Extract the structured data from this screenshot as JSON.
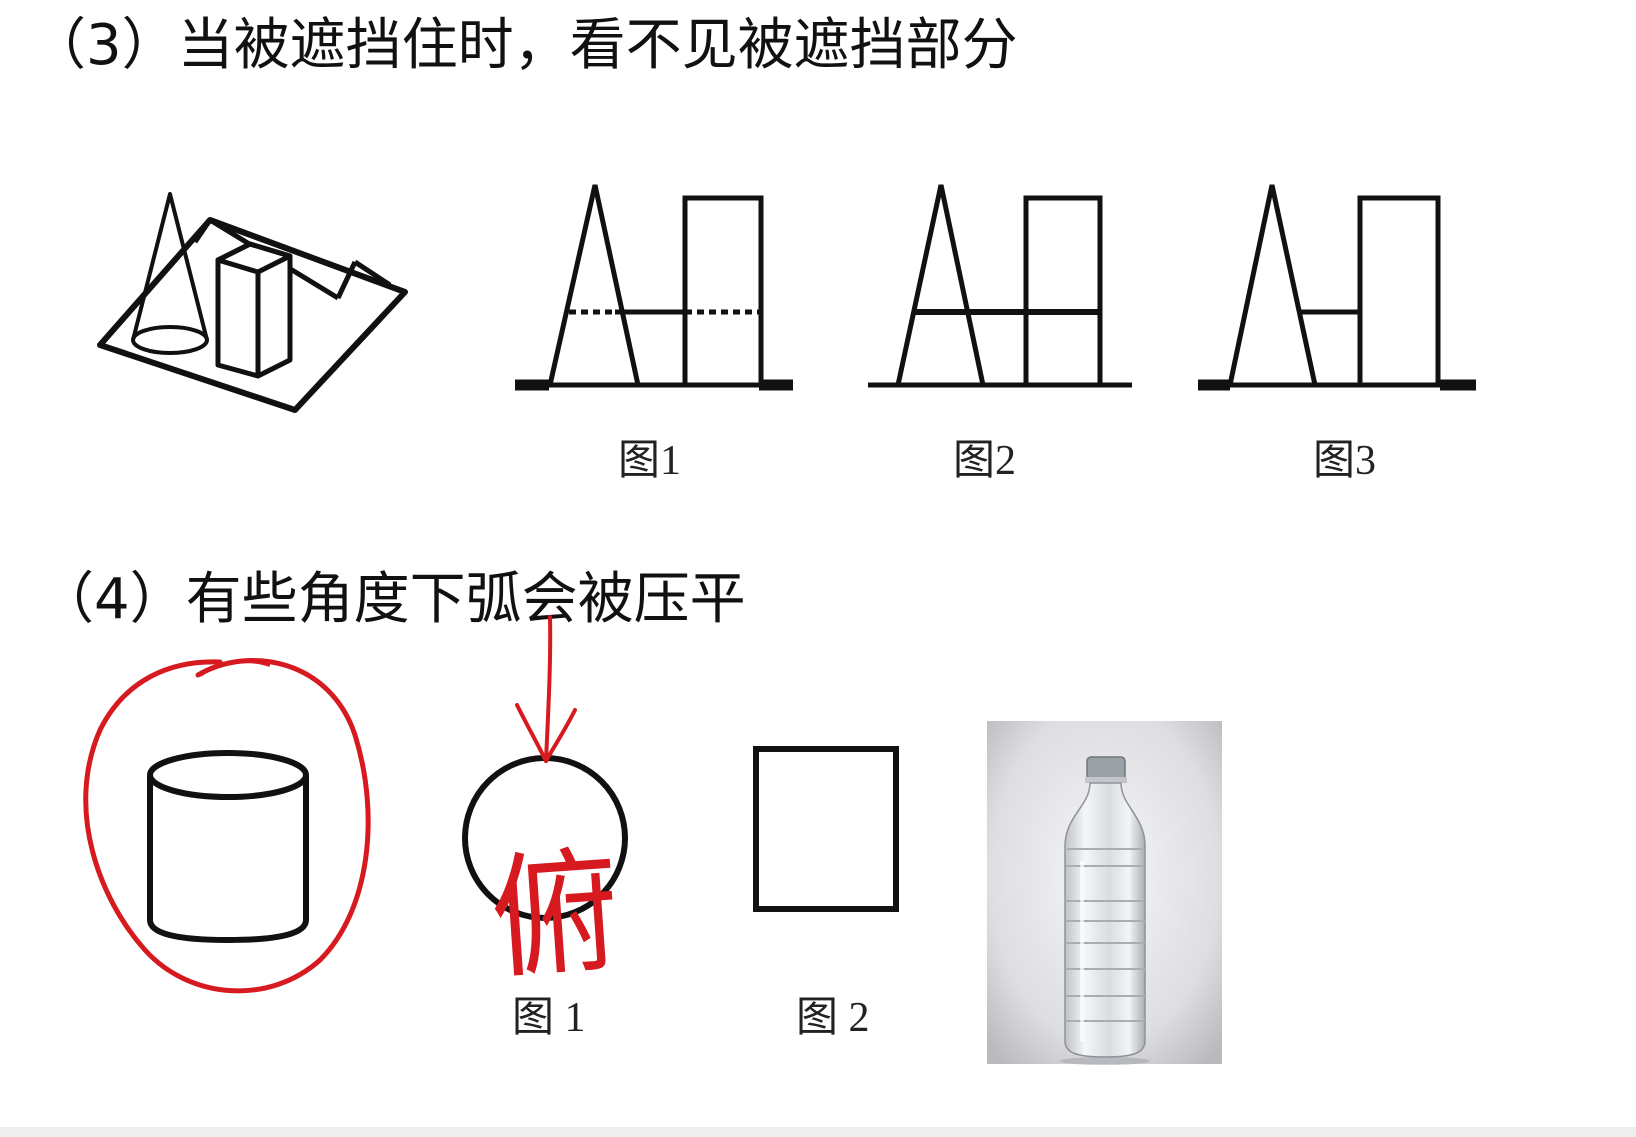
{
  "section3": {
    "heading": "（3）当被遮挡住时，看不见被遮挡部分",
    "figure_labels": [
      "图1",
      "图2",
      "图3"
    ]
  },
  "section4": {
    "heading": "（4）有些角度下弧会被压平",
    "figure_labels": [
      "图 1",
      "图 2"
    ],
    "annotation": {
      "handwritten_char": "俯",
      "ink_color": "#d61a1f"
    }
  },
  "colors": {
    "ink": "#111111",
    "annotation_red": "#d61a1f"
  },
  "icons": {
    "bottle_photo": "water-bottle-photo"
  }
}
